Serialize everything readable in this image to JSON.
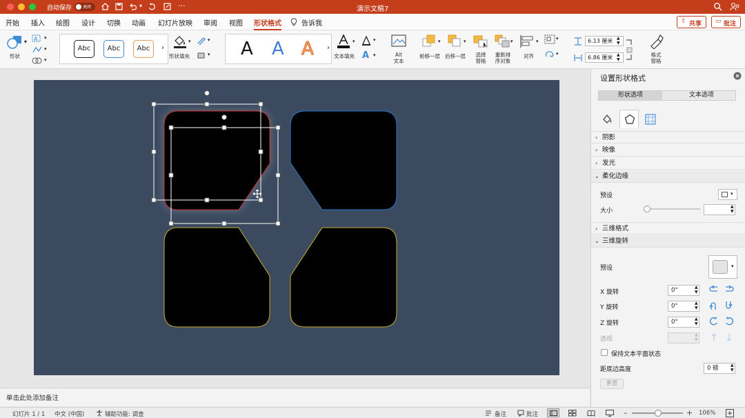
{
  "titlebar": {
    "autosave_label": "自动保存",
    "autosave_state": "关闭",
    "title": "演示文稿7",
    "more": "···"
  },
  "tabs": [
    "开始",
    "插入",
    "绘图",
    "设计",
    "切换",
    "动画",
    "幻灯片放映",
    "审阅",
    "视图",
    "形状格式",
    "告诉我"
  ],
  "active_tab": "形状格式",
  "share": {
    "share_label": "共享",
    "comment_label": "批注"
  },
  "ribbon": {
    "shape_label": "形状",
    "styles": [
      "Abc",
      "Abc",
      "Abc"
    ],
    "shape_fill_label": "形状填充",
    "wordart": [
      "A",
      "A",
      "A"
    ],
    "text_fill_label": "文本填充",
    "alt_text_label": "Alt 文本",
    "bring_forward_label": "前移一层",
    "send_backward_label": "后移一层",
    "selection_pane_label": "选择 窗格",
    "reorder_label": "重新排 序对象",
    "align_label": "对齐",
    "height_value": "6.13 厘米",
    "width_value": "6.86 厘米",
    "format_pane_label": "格式 窗格"
  },
  "pane": {
    "title": "设置形状格式",
    "tab_shape": "形状选项",
    "tab_text": "文本选项",
    "sections": {
      "shadow": "阴影",
      "reflection": "映像",
      "glow": "发光",
      "soft_edges": "柔化边缘",
      "three_d_format": "三维格式",
      "three_d_rotation": "三维旋转"
    },
    "soft_edges": {
      "preset_label": "预设",
      "size_label": "大小"
    },
    "rotation": {
      "preset_label": "预设",
      "x_label": "X 旋转",
      "x_value": "0°",
      "y_label": "Y 旋转",
      "y_value": "0°",
      "z_label": "Z 旋转",
      "z_value": "0°",
      "perspective_label": "透视",
      "keep_flat_label": "保持文本平面状态",
      "distance_label": "距底边高度",
      "distance_value": "0 磅",
      "reset_label": "重置"
    }
  },
  "notes_placeholder": "单击此处添加备注",
  "status": {
    "slide": "幻灯片 1 / 1",
    "language": "中文 (中国)",
    "accessibility": "辅助功能: 调查",
    "notes": "备注",
    "comments": "批注",
    "zoom": "106%"
  },
  "colors": {
    "accent": "#c43e1c",
    "slide_bg": "#3c4a5f",
    "shape_fill": "#000000",
    "outline_red": "#c8302a",
    "outline_blue": "#2a78c8",
    "outline_yellow": "#c8b02a",
    "icon_blue": "#3d8bd6"
  }
}
